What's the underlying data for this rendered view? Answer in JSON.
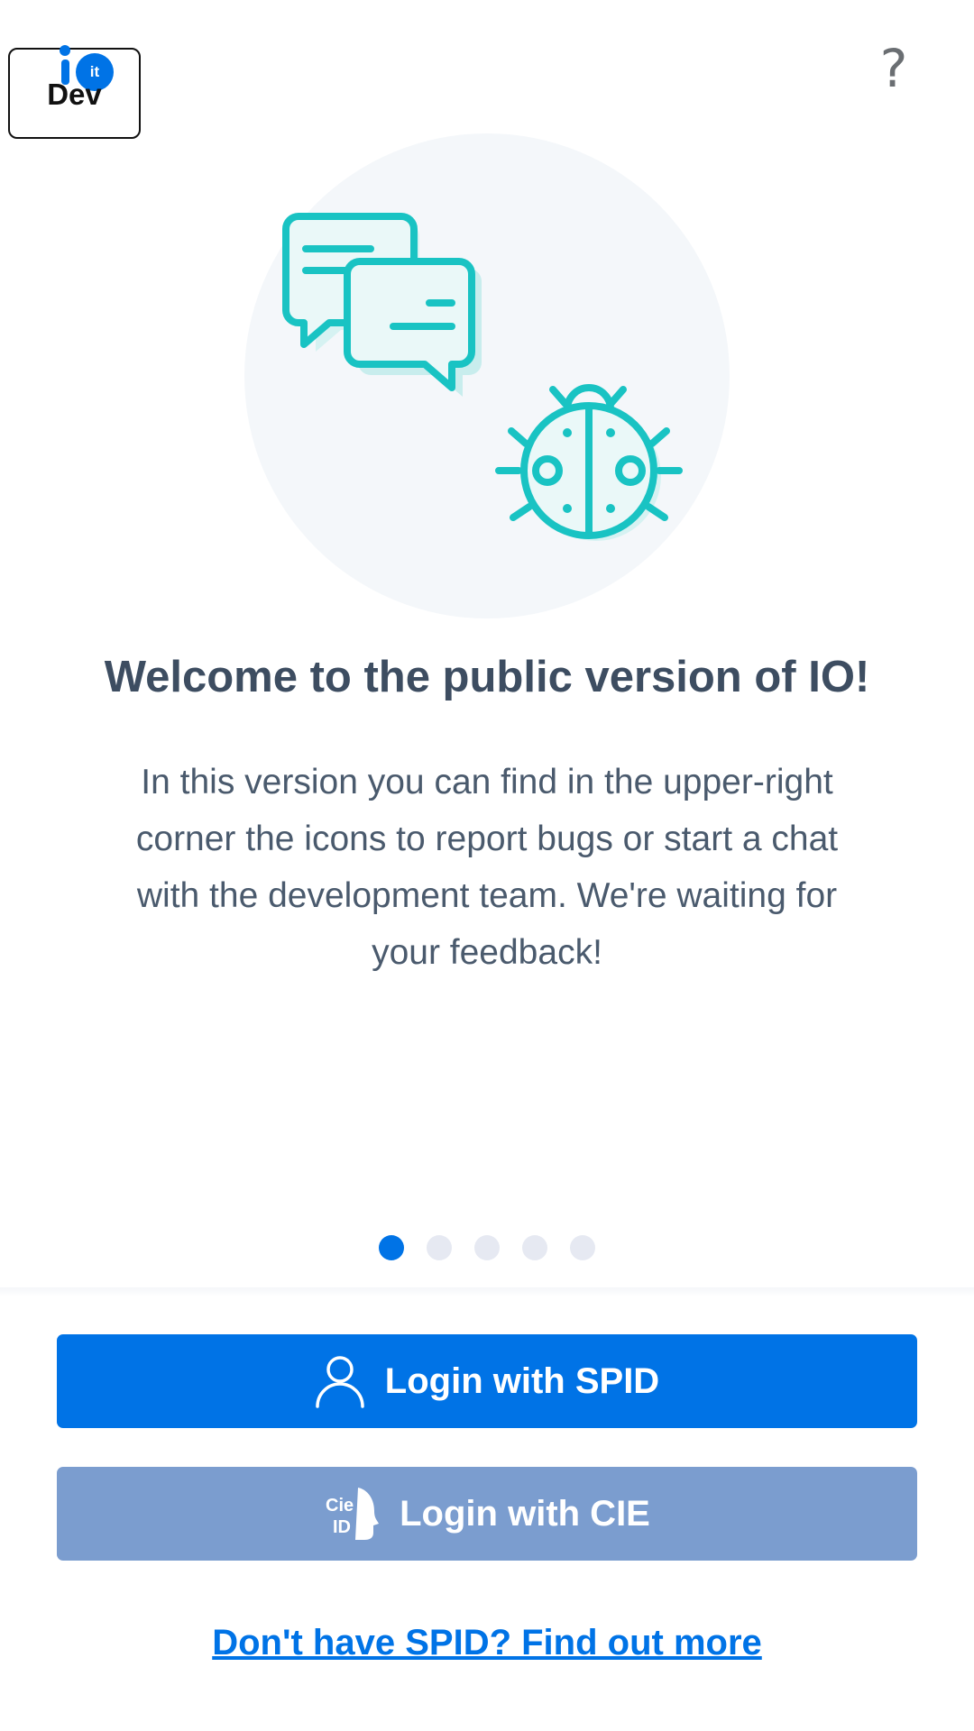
{
  "header": {
    "badge_domain": "it",
    "badge_label": "Dev",
    "help_label": "?"
  },
  "illustration": {
    "icons": [
      "chat-bubbles-icon",
      "bug-icon"
    ],
    "accent_color": "#19c3c3"
  },
  "content": {
    "title": "Welcome to the public version of IO!",
    "description": "In this version you can find in the upper-right corner the icons to report bugs or start a chat with the development team. We're waiting for your feedback!"
  },
  "pager": {
    "total": 5,
    "active_index": 0
  },
  "actions": {
    "spid_button": {
      "label": "Login with SPID",
      "icon": "user-icon"
    },
    "cie_button": {
      "label": "Login with CIE",
      "icon": "cie-id-icon"
    },
    "spid_link": "Don't have SPID? Find out more"
  },
  "colors": {
    "primary": "#0073e6",
    "cie_button": "#7b9dcf",
    "title_text": "#3d4d61"
  }
}
